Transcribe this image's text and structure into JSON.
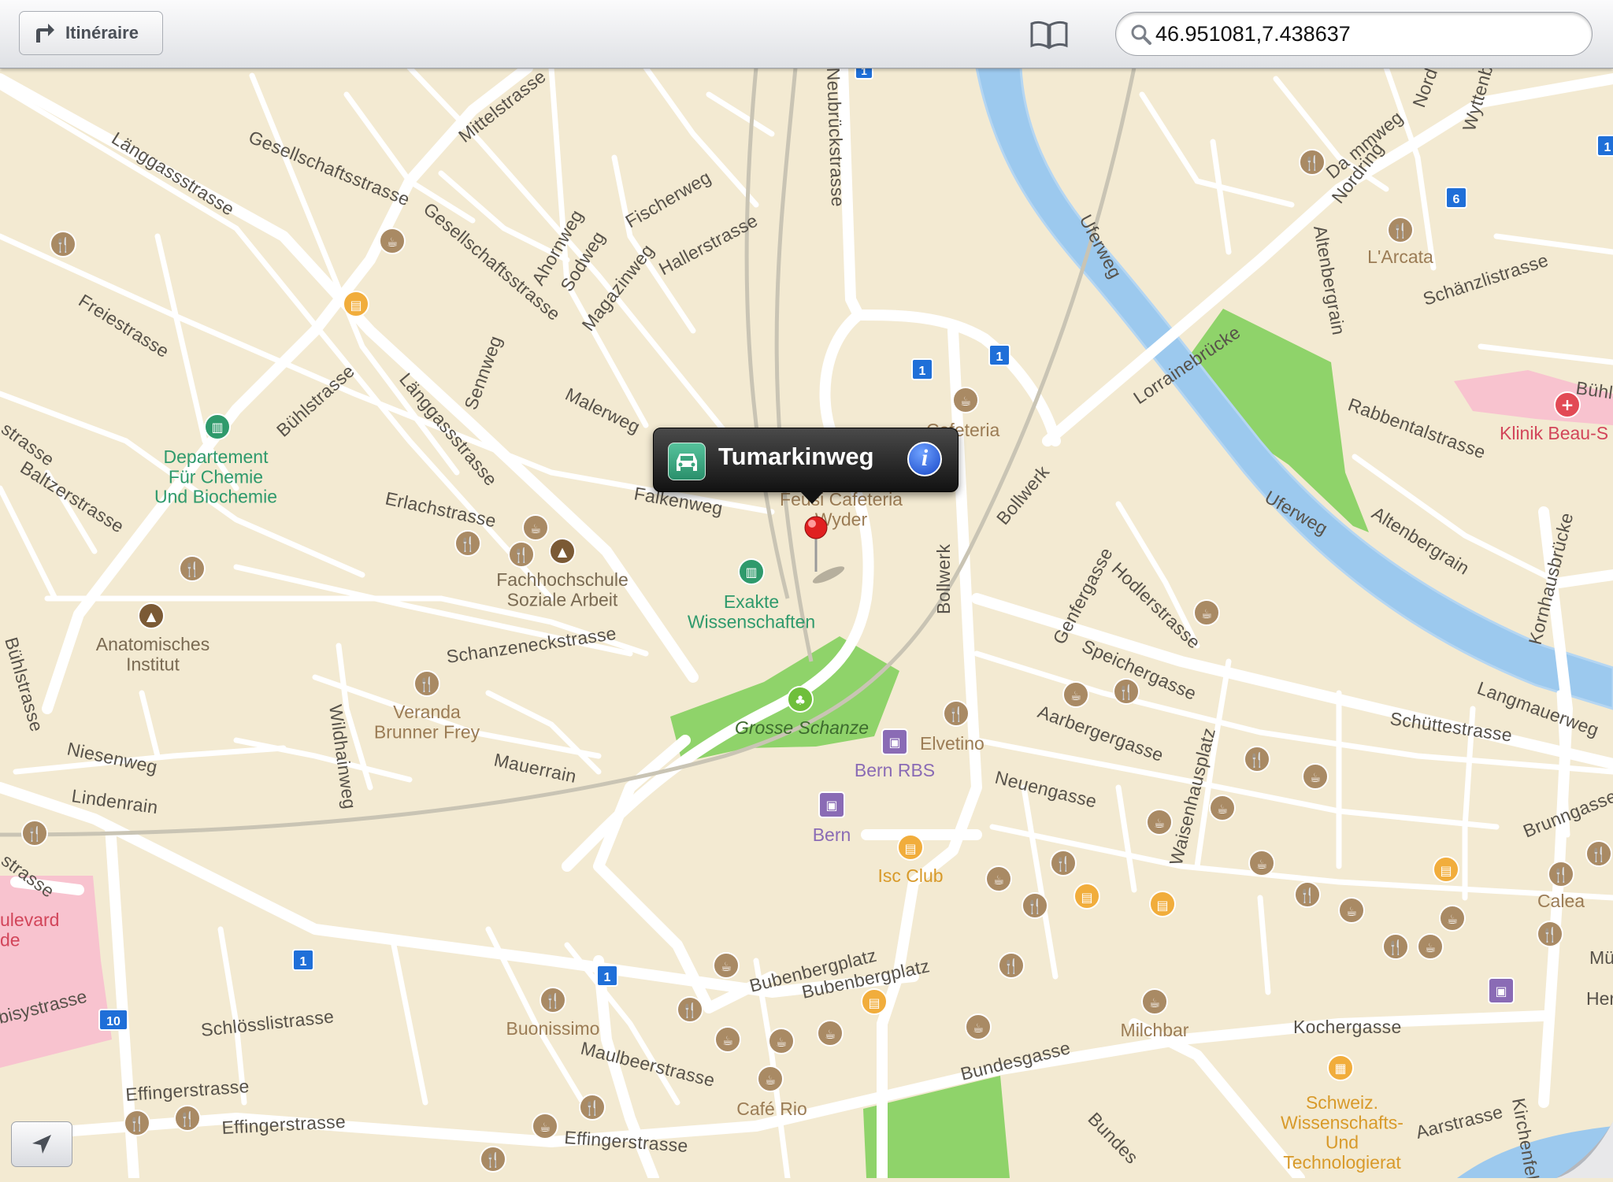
{
  "toolbar": {
    "route_label": "Itinéraire",
    "bookmarks_icon": "book-icon",
    "search_value": "46.951081,7.438637"
  },
  "callout": {
    "title": "Tumarkinweg",
    "icon_left": "car-icon",
    "icon_right": "info-icon"
  },
  "colors": {
    "land": "#f3ead2",
    "road": "#ffffff",
    "river": "#9cc9ee",
    "park": "#8fd36a",
    "hospital": "#f8c3cf",
    "poi_brown": "#a98a64",
    "poi_orange": "#f1ad3c",
    "poi_green": "#2f9a6c",
    "poi_purple": "#8a6bb5",
    "route_shield": "#1f6fd8"
  },
  "streets": [
    "Mittelstrasse",
    "Gesellschaftsstrasse",
    "Länggassstrasse",
    "Gesellschaftsstrasse",
    "Ahornweg",
    "Sodweg",
    "Magazinweg",
    "Fischerweg",
    "Hallerstrasse",
    "Freiestrasse",
    "Bühlstrasse",
    "Sennweg",
    "Länggassstrasse",
    "Malerweg",
    "Baltzerstrasse",
    "Erlachstrasse",
    "Falkenweg",
    "Bühlstrasse",
    "Schanzeneckstrasse",
    "Wildhainweg",
    "Niesenweg",
    "Lindenrain",
    "Mauerrain",
    "Bollwerk",
    "Bollwerk",
    "Uferweg",
    "Lorrainebrücke",
    "Nordring",
    "Altenbergrain",
    "Schänzlistrasse",
    "Rabbentalstrasse",
    "Uferweg",
    "Altenbergrain",
    "Genfergasse",
    "Hodlerstrasse",
    "Speichergasse",
    "Aarbergergasse",
    "Neuengasse",
    "Waisenhausplatz",
    "Schüttestrasse",
    "Langmauerweg",
    "Kornhausbrücke",
    "Brunngasse",
    "Bubenbergplatz",
    "Bubenbergplatz",
    "Schlösslistrasse",
    "Maulbeerstrasse",
    "Effingerstrasse",
    "Effingerstrasse",
    "Effingerstrasse",
    "Bundesgasse",
    "Kochergasse",
    "Aarstrasse",
    "Kirchenfeld",
    "Bundes",
    "Neubrückstrasse",
    "Wyttenb",
    "Nord",
    "Da mmweg",
    "strasse",
    "strasse",
    "Bühlstrasse"
  ],
  "places": {
    "chemistry": "Departement\nFür Chemie\nUnd Biochemie",
    "fachhochschule": "Fachhochschule\nSoziale Arbeit",
    "anatomy": "Anatomisches\nInstitut",
    "exakte": "Exakte\nWissenschaften",
    "veranda": "Veranda\nBrunner Frey",
    "grosse_schanze": "Grosse Schanze",
    "bern_rbs": "Bern RBS",
    "elvetino": "Elvetino",
    "bern": "Bern",
    "isc_club": "Isc Club",
    "cafeteria": "Cafeteria",
    "feusi": "Feusi Cafeteria\nWyder",
    "larcata": "L'Arcata",
    "klinik": "Klinik Beau-S",
    "buonissimo": "Buonissimo",
    "cafe_rio": "Café Rio",
    "milchbar": "Milchbar",
    "calea": "Calea",
    "schweiz": "Schweiz.\nWissenschafts-\nUnd\nTechnologierat",
    "boulevard": "ulevard\nde",
    "bisystrasse": "bisystrasse",
    "muh": "Mü",
    "herr": "Herr"
  },
  "route_shields": [
    "1",
    "1",
    "1",
    "1",
    "1",
    "1",
    "6",
    "10"
  ]
}
